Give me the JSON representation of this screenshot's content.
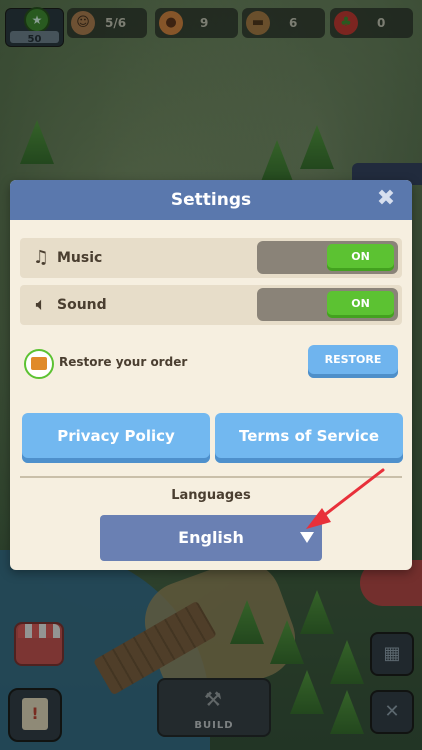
{
  "hud": {
    "level": "50",
    "workers": "5/6",
    "food": "9",
    "wood": "6",
    "berries": "0"
  },
  "game": {
    "build_label": "BUILD"
  },
  "settings": {
    "title": "Settings",
    "close_icon": "close-icon",
    "music": {
      "label": "Music",
      "state": "ON"
    },
    "sound": {
      "label": "Sound",
      "state": "ON"
    },
    "restore": {
      "label": "Restore your order",
      "button": "RESTORE"
    },
    "privacy_label": "Privacy Policy",
    "terms_label": "Terms of Service",
    "languages_heading": "Languages",
    "language_value": "English"
  },
  "colors": {
    "header": "#5a78ad",
    "toggle_on": "#5cc232",
    "button_blue": "#72b8f0",
    "annotation_arrow": "#e8303a"
  }
}
